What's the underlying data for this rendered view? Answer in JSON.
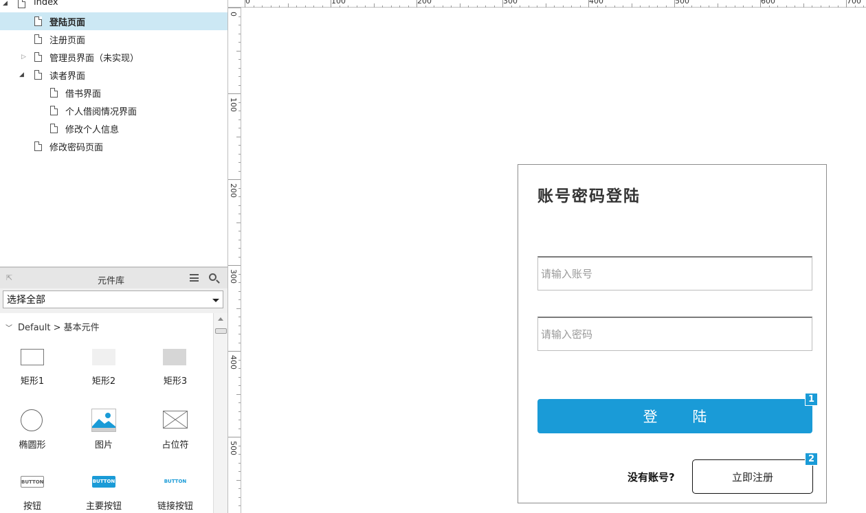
{
  "tree": {
    "root": "index",
    "items": [
      {
        "label": "登陆页面"
      },
      {
        "label": "注册页面"
      },
      {
        "label": "管理员界面（未实现）"
      },
      {
        "label": "读者界面"
      },
      {
        "label": "借书界面"
      },
      {
        "label": "个人借阅情况界面"
      },
      {
        "label": "修改个人信息"
      },
      {
        "label": "修改密码页面"
      }
    ]
  },
  "library": {
    "title": "元件库",
    "select_value": "选择全部",
    "group": "Default > 基本元件",
    "widgets": [
      {
        "label": "矩形1",
        "icon": "rectangle-outline-icon"
      },
      {
        "label": "矩形2",
        "icon": "rectangle-light-icon"
      },
      {
        "label": "矩形3",
        "icon": "rectangle-gray-icon"
      },
      {
        "label": "椭圆形",
        "icon": "ellipse-icon"
      },
      {
        "label": "图片",
        "icon": "image-icon"
      },
      {
        "label": "占位符",
        "icon": "placeholder-icon"
      },
      {
        "label": "按钮",
        "icon": "button-icon",
        "preview_text": "BUTTON"
      },
      {
        "label": "主要按钮",
        "icon": "primary-button-icon",
        "preview_text": "BUTTON"
      },
      {
        "label": "链接按钮",
        "icon": "link-button-icon",
        "preview_text": "BUTTON"
      }
    ]
  },
  "rulers": {
    "top": [
      "0",
      "100",
      "200",
      "300",
      "400",
      "500",
      "600",
      "700"
    ],
    "left": [
      "0",
      "100",
      "200",
      "300",
      "400",
      "500"
    ]
  },
  "login": {
    "title": "账号密码登陆",
    "account_placeholder": "请输入账号",
    "password_placeholder": "请输入密码",
    "login_label": "登 陆",
    "no_account": "没有账号?",
    "register_label": "立即注册",
    "badge_login": "1",
    "badge_register": "2"
  },
  "colors": {
    "accent": "#1a9bd7",
    "selected_row": "#cce8f4"
  }
}
